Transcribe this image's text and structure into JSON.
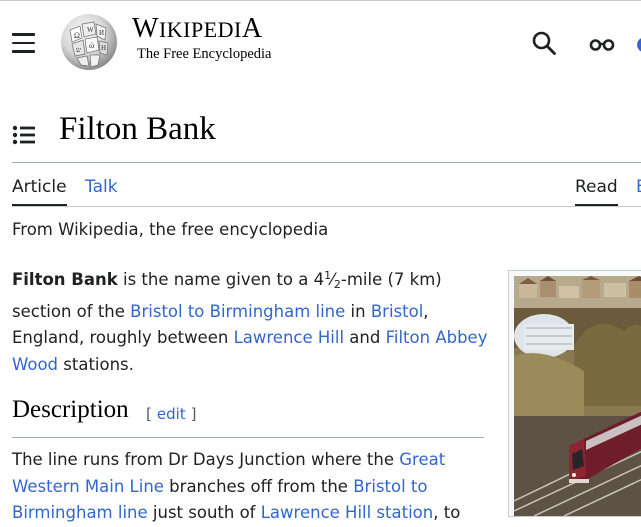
{
  "header": {
    "menu_icon": "hamburger-menu-icon",
    "logo_icon": "wikipedia-globe-logo",
    "wordmark_first": "W",
    "wordmark_small": "IKIPEDI",
    "wordmark_last": "A",
    "tagline": "The Free Encyclopedia",
    "search_icon": "search-icon",
    "anon_icon": "glasses-anonymous-user-icon"
  },
  "page": {
    "title": "Filton Bank",
    "toc_icon": "table-of-contents-icon"
  },
  "tabs": {
    "article": "Article",
    "talk": "Talk",
    "read": "Read"
  },
  "content": {
    "from": "From Wikipedia, the free encyclopedia",
    "lead": {
      "bold": "Filton Bank",
      "t1": " is the name given to a 4",
      "frac_num": "1",
      "frac_slash": "⁄",
      "frac_den": "2",
      "t2": "-mile (7 km) section of the ",
      "link1": "Bristol to Birmingham line",
      "t3": " in ",
      "link2": "Bristol",
      "t4": ", England, roughly between ",
      "link3": "Lawrence Hill",
      "t5": " and ",
      "link4": "Filton Abbey Wood",
      "t6": " stations."
    },
    "section": {
      "heading": "Description",
      "bracket_open": "[",
      "edit": "edit",
      "bracket_close": "]"
    },
    "desc": {
      "t1": "The line runs from Dr Days Junction where the ",
      "link1": "Great Western Main Line",
      "t2": " branches off from the ",
      "link2": "Bristol to Birmingham line",
      "t3": " just south of ",
      "link3": "Lawrence Hill station",
      "t4": ", to"
    }
  },
  "colors": {
    "link": "#3366cc",
    "text": "#202122",
    "rule": "#a2a9b1"
  }
}
